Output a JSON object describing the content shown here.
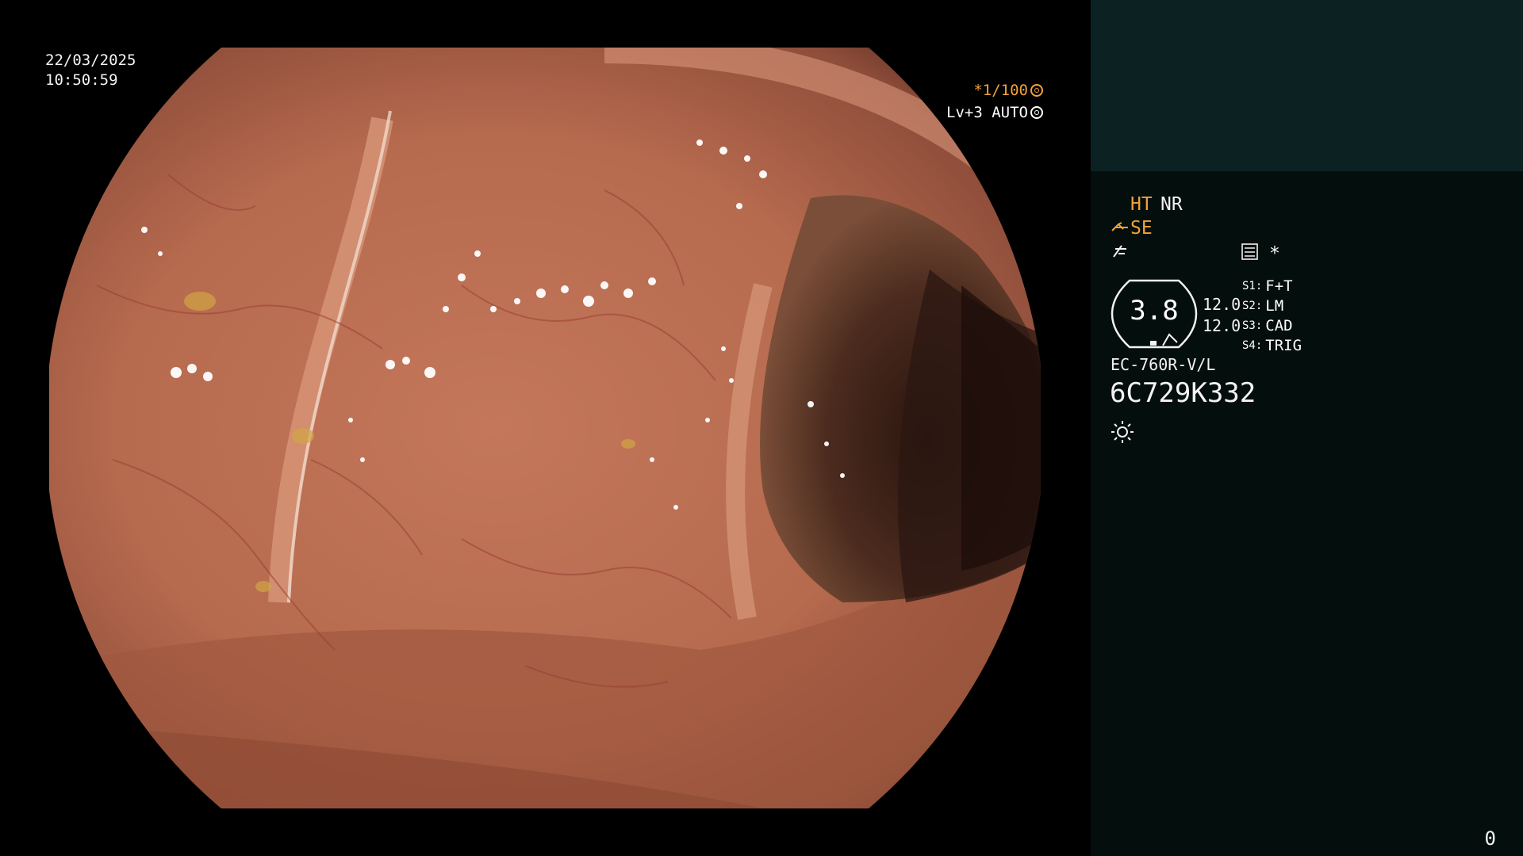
{
  "overlay": {
    "date": "22/03/2025",
    "time": "10:50:59",
    "shutter": "*1/100",
    "shutter_icon": "aperture-icon",
    "exposure_mode": "Lv+3 AUTO",
    "exposure_icon": "iris-icon"
  },
  "panel": {
    "ht_label": "HT",
    "nr_label": "NR",
    "se_label": "SE",
    "star_label": "*",
    "zoom_value": "3.8",
    "level_1": "12.0",
    "level_2": "12.0",
    "modes": [
      {
        "key": "S1:",
        "value": "F+T"
      },
      {
        "key": "S2:",
        "value": "LM"
      },
      {
        "key": "S3:",
        "value": "CAD"
      },
      {
        "key": "S4:",
        "value": "TRIG"
      }
    ],
    "scope_model": "EC-760R-V/L",
    "serial": "6C729K332",
    "light_icon": "sun-icon"
  },
  "counter": "0",
  "colors": {
    "accent": "#f0a23a",
    "panel_bg": "#040e0c",
    "panel_header_bg": "#0c2222",
    "text": "#f2f2f2"
  }
}
